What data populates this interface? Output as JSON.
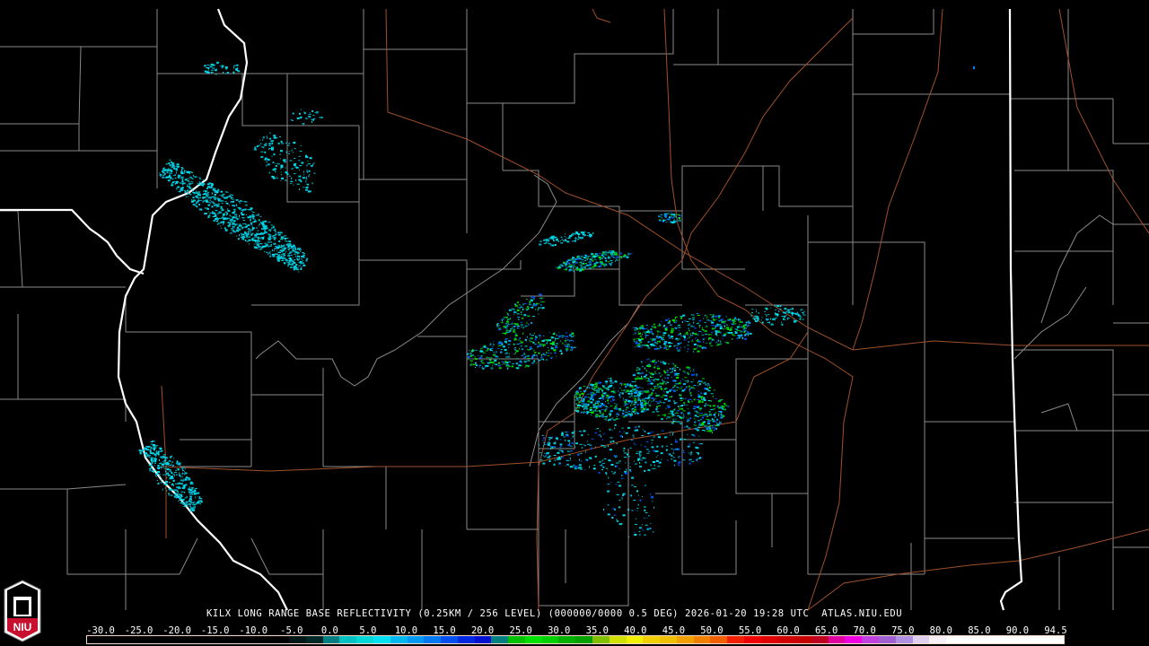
{
  "product": {
    "title": "KILX LONG RANGE BASE REFLECTIVITY (0.25KM / 256 LEVEL) (000000/0000 0.5 DEG) 2026-01-20 19:28 UTC  ATLAS.NIU.EDU"
  },
  "logo": {
    "text": "NIU",
    "icon": "niu-logo-icon"
  },
  "colorbar": {
    "labels": [
      "-30.0",
      "-25.0",
      "-20.0",
      "-15.0",
      "-10.0",
      "-5.0",
      "0.0",
      "5.0",
      "10.0",
      "15.0",
      "20.0",
      "25.0",
      "30.0",
      "35.0",
      "40.0",
      "45.0",
      "50.0",
      "55.0",
      "60.0",
      "65.0",
      "70.0",
      "75.0",
      "80.0",
      "85.0",
      "90.0",
      "94.5"
    ],
    "colors": [
      "#000000",
      "#000000",
      "#000000",
      "#000000",
      "#000000",
      "#000000",
      "#000000",
      "#000000",
      "#000000",
      "#000000",
      "#000000",
      "#000000",
      "#001818",
      "#002828",
      "#008080",
      "#00c0c0",
      "#00d8d8",
      "#00e0f0",
      "#00b8f0",
      "#0098f0",
      "#0078f0",
      "#0050f0",
      "#0028e0",
      "#0010d0",
      "#008080",
      "#00c000",
      "#00e000",
      "#00d000",
      "#00b000",
      "#00a000",
      "#80c000",
      "#d0e000",
      "#f0f000",
      "#f0d000",
      "#f0c000",
      "#f0a000",
      "#f08000",
      "#f06000",
      "#f02000",
      "#f00000",
      "#e00000",
      "#d00000",
      "#c80000",
      "#c00020",
      "#e000a0",
      "#f000e0",
      "#c040e0",
      "#a060d0",
      "#b090e0",
      "#e0d0f0",
      "#f8f0f8",
      "#ffffff",
      "#ffffff",
      "#ffffff",
      "#ffffff",
      "#ffffff",
      "#ffffff",
      "#ffffff"
    ]
  },
  "colors": {
    "state": "#ffffff",
    "county": "#8a8a8a",
    "road": "#a0502a",
    "echo_light": "#00d0e0"
  }
}
